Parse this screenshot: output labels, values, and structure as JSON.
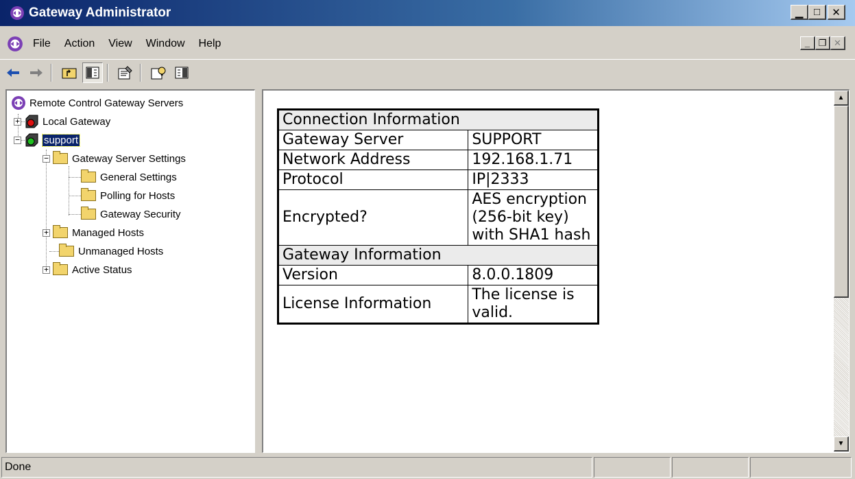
{
  "window": {
    "title": "Gateway Administrator"
  },
  "menu": {
    "items": [
      "File",
      "Action",
      "View",
      "Window",
      "Help"
    ]
  },
  "toolbar": {
    "buttons": [
      "back-arrow-icon",
      "forward-arrow-icon",
      "up-folder-icon",
      "show-tree-icon",
      "properties-icon",
      "help-icon",
      "show-description-icon"
    ]
  },
  "tree": {
    "root": "Remote Control Gateway Servers",
    "local_gateway": "Local Gateway",
    "support": "support",
    "gateway_server_settings": "Gateway Server Settings",
    "general_settings": "General Settings",
    "polling_for_hosts": "Polling for Hosts",
    "gateway_security": "Gateway Security",
    "managed_hosts": "Managed Hosts",
    "unmanaged_hosts": "Unmanaged Hosts",
    "active_status": "Active Status",
    "expanders": {
      "plus": "+",
      "minus": "−"
    }
  },
  "info": {
    "connection_header": "Connection Information",
    "gateway_server_label": "Gateway Server",
    "gateway_server_value": "SUPPORT",
    "network_address_label": "Network Address",
    "network_address_value": "192.168.1.71",
    "protocol_label": "Protocol",
    "protocol_value": "IP|2333",
    "encrypted_label": "Encrypted?",
    "encrypted_value": "AES encryption (256-bit key) with SHA1 hash",
    "gateway_header": "Gateway Information",
    "version_label": "Version",
    "version_value": "8.0.0.1809",
    "license_label": "License Information",
    "license_value": "The license is valid."
  },
  "status": {
    "text": "Done"
  },
  "colors": {
    "titlebar": "#0a246a",
    "selection": "#0a246a",
    "face": "#d4d0c8",
    "folder": "#f2d46c"
  }
}
